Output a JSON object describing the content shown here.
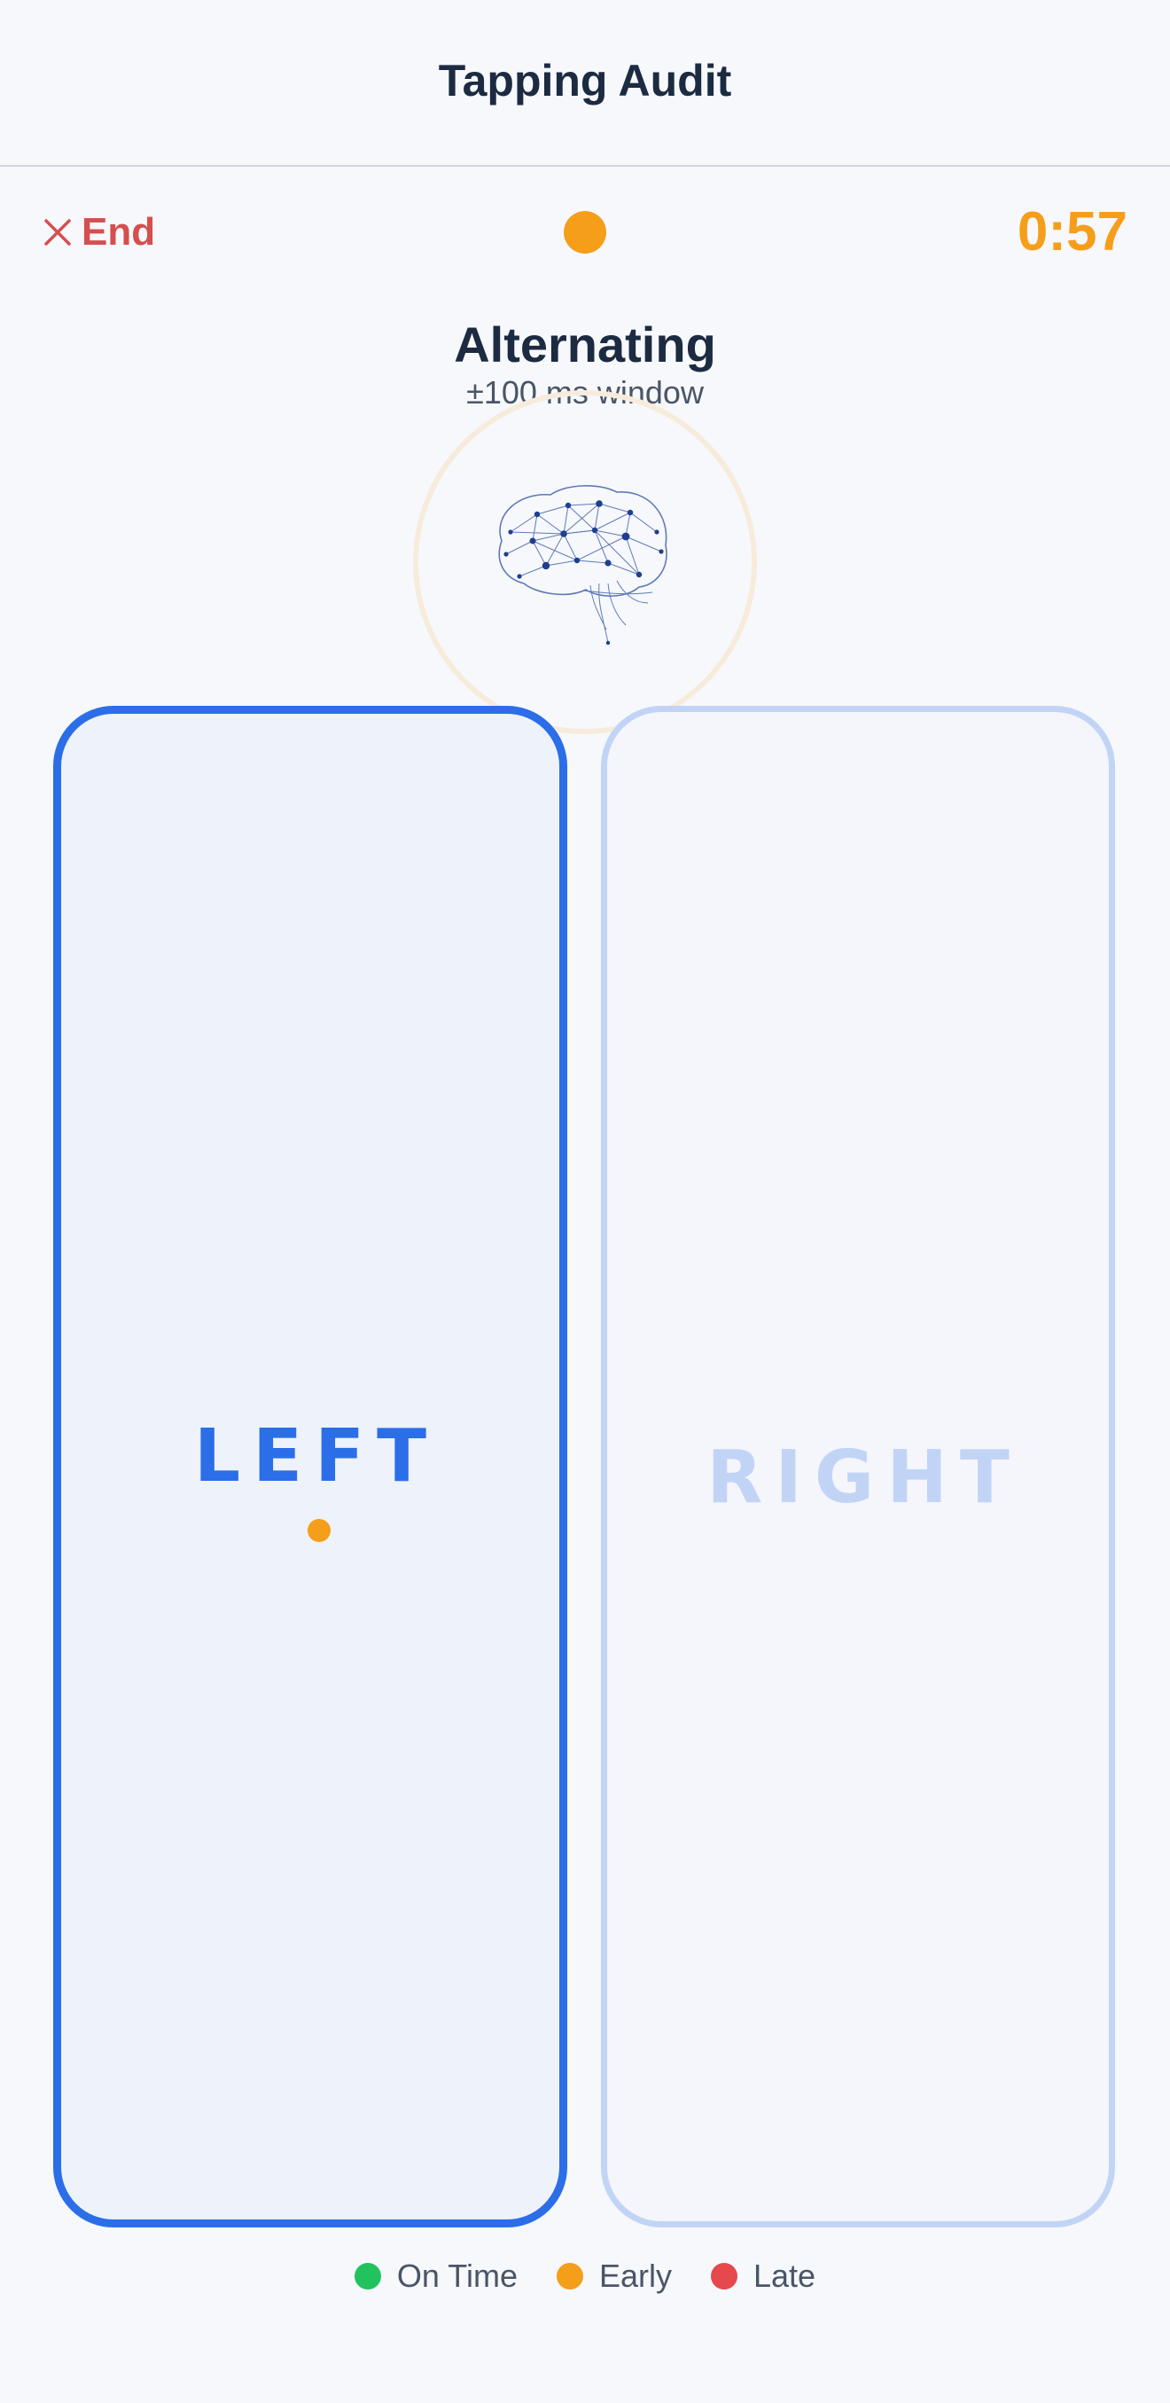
{
  "header": {
    "title": "Tapping Audit"
  },
  "controls": {
    "end_label": "End",
    "end_icon": "close-icon",
    "status_color": "#f59e1a",
    "timer": "0:57"
  },
  "mode": {
    "title": "Alternating",
    "subtitle": "±100 ms window",
    "illustration": "brain-icon"
  },
  "panels": {
    "left": {
      "label": "LEFT",
      "active": true,
      "last_tap": "early"
    },
    "right": {
      "label": "RIGHT",
      "active": false
    }
  },
  "legend": [
    {
      "label": "On Time",
      "color": "#22c35e"
    },
    {
      "label": "Early",
      "color": "#f59e1a"
    },
    {
      "label": "Late",
      "color": "#e5484d"
    }
  ],
  "colors": {
    "accent": "#2b6ee8",
    "accent_inactive": "#c2d4f6",
    "danger": "#d64e4e",
    "warning": "#f59e1a",
    "text": "#1c2b41"
  }
}
